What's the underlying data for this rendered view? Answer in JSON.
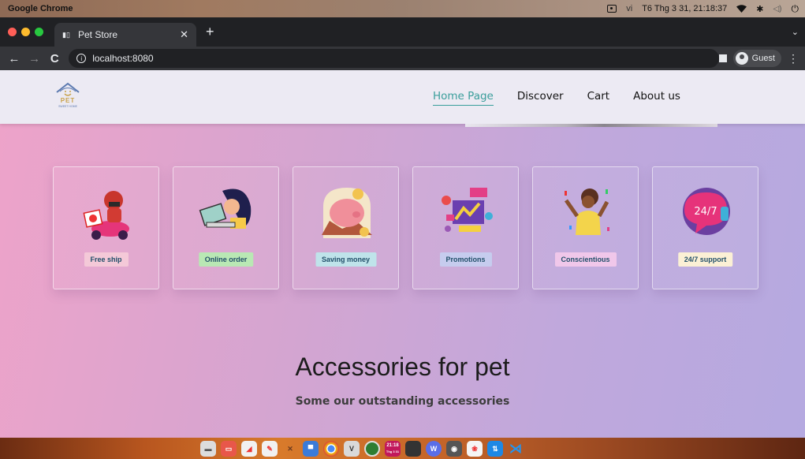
{
  "os_bar": {
    "app_name": "Google Chrome",
    "input_source": "vi",
    "datetime": "T6 Thg 3 31, 21:18:37"
  },
  "browser": {
    "tab_title": "Pet Store",
    "tab_favicon": "paw-favicon",
    "url": "localhost:8080",
    "profile_label": "Guest"
  },
  "site": {
    "logo_text": "PET",
    "logo_subtext": "SWEET HOME",
    "nav": [
      {
        "label": "Home Page",
        "active": true
      },
      {
        "label": "Discover",
        "active": false
      },
      {
        "label": "Cart",
        "active": false
      },
      {
        "label": "About us",
        "active": false
      }
    ],
    "features": [
      {
        "label": "Free ship",
        "icon": "delivery-scooter-icon",
        "badge_color": "#f4c9d8"
      },
      {
        "label": "Online order",
        "icon": "laptop-shopping-icon",
        "badge_color": "#b9e8b4"
      },
      {
        "label": "Saving money",
        "icon": "piggy-bank-icon",
        "badge_color": "#bfe3ea"
      },
      {
        "label": "Promotions",
        "icon": "sale-promotion-icon",
        "badge_color": "#c6ccee"
      },
      {
        "label": "Conscientious",
        "icon": "celebration-person-icon",
        "badge_color": "#f0c7ea"
      },
      {
        "label": "24/7 support",
        "icon": "support-chat-icon",
        "badge_color": "#fbf0d5"
      }
    ],
    "section_title": "Accessories for pet",
    "section_subtitle": "Some our outstanding accessories"
  },
  "dock": {
    "clock_time": "21:18",
    "clock_date": "Thg 3 31",
    "apps": [
      "files-icon",
      "image-viewer-icon",
      "text-editor-icon",
      "draw-icon",
      "tools-icon",
      "folder-icon",
      "chrome-icon",
      "vmware-icon",
      "app-circle-icon",
      "clock-icon",
      "terminal-icon",
      "wps-icon",
      "camera-icon",
      "settings-icon",
      "transfer-icon",
      "vscode-icon"
    ]
  }
}
